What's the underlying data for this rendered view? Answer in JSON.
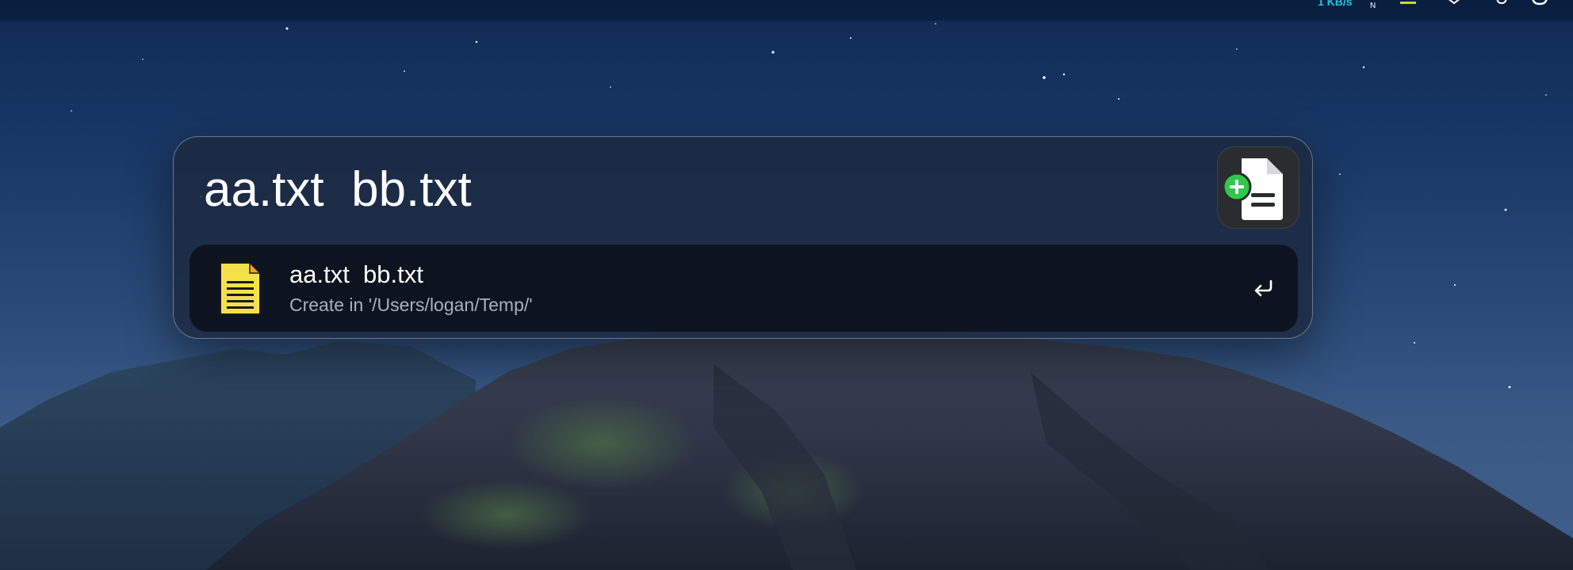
{
  "menubar": {
    "network_speed": "1 KB/s",
    "network_unit": "N"
  },
  "launcher": {
    "query": "aa.txt  bb.txt",
    "app_icon": "new-file-icon"
  },
  "results": [
    {
      "icon": "text-file-icon",
      "title": "aa.txt  bb.txt",
      "subtitle": "Create in '/Users/logan/Temp/'",
      "action_icon": "return-key-icon"
    }
  ],
  "colors": {
    "accent_plus": "#2ec84a",
    "file_yellow": "#f4e14a",
    "file_orange": "#f0a030",
    "net_speed": "#18c6e0"
  }
}
